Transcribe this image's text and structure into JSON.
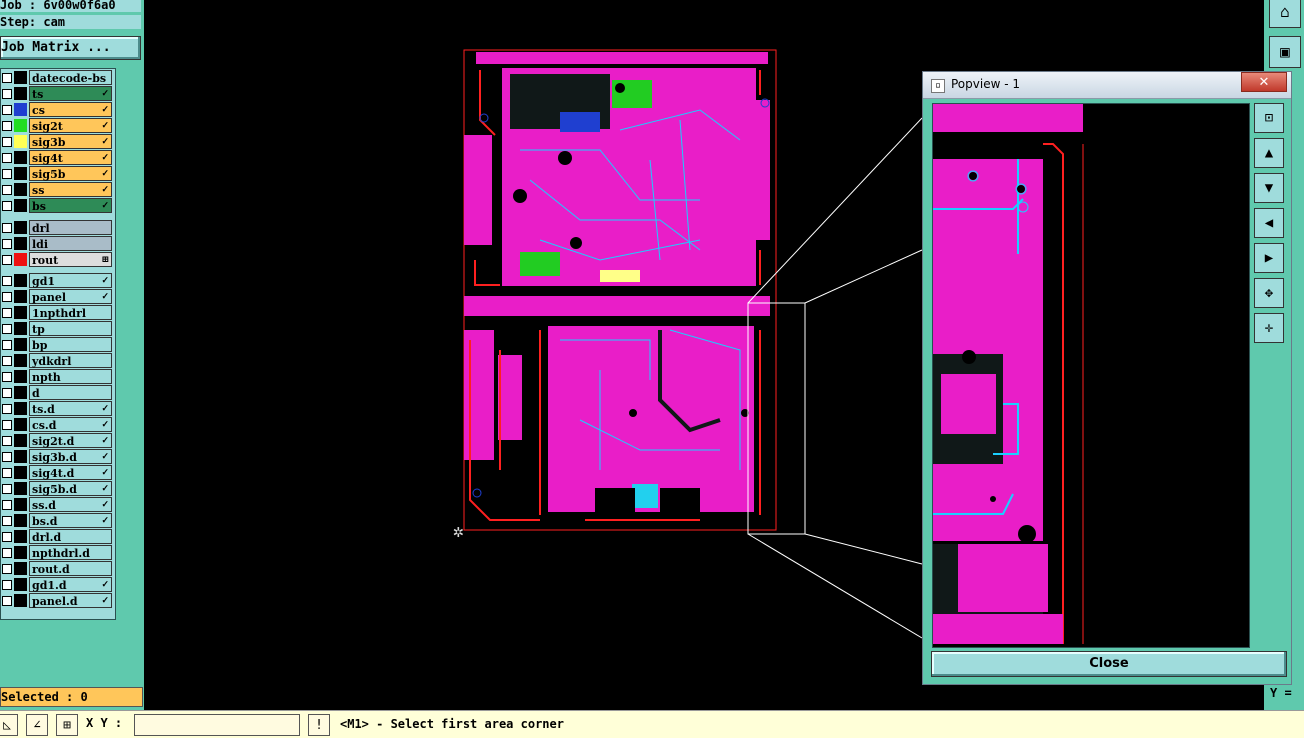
{
  "header": {
    "job_label": "Job : 6v00w0f6a0",
    "step_label": "Step: cam",
    "job_matrix_button": "Job Matrix ..."
  },
  "layers": [
    {
      "name": "datecode-bs",
      "color": "#9fdcdc",
      "swatch": "#000000",
      "tick": ""
    },
    {
      "name": "ts",
      "color": "#2e8b57",
      "swatch": "#000000",
      "tick": "✓"
    },
    {
      "name": "cs",
      "color": "#ffc65a",
      "swatch": "#1f3fd0",
      "tick": "✓"
    },
    {
      "name": "sig2t",
      "color": "#ffc65a",
      "swatch": "#22dd22",
      "tick": "✓"
    },
    {
      "name": "sig3b",
      "color": "#ffc65a",
      "swatch": "#ffff55",
      "tick": "✓"
    },
    {
      "name": "sig4t",
      "color": "#ffc65a",
      "swatch": "#000000",
      "tick": "✓"
    },
    {
      "name": "sig5b",
      "color": "#ffc65a",
      "swatch": "#000000",
      "tick": "✓"
    },
    {
      "name": "ss",
      "color": "#ffc65a",
      "swatch": "#000000",
      "tick": "✓"
    },
    {
      "name": "bs",
      "color": "#2e8b57",
      "swatch": "#000000",
      "tick": "✓"
    },
    {
      "name": "drl",
      "color": "#a9bcc8",
      "swatch": "#000000",
      "tick": ""
    },
    {
      "name": "ldi",
      "color": "#a9bcc8",
      "swatch": "#000000",
      "tick": ""
    },
    {
      "name": "rout",
      "color": "#dddddd",
      "swatch": "#ee1111",
      "tick": "⊞"
    },
    {
      "name": "gd1",
      "color": "#9fdcdc",
      "swatch": "#000000",
      "tick": "✓"
    },
    {
      "name": "panel",
      "color": "#9fdcdc",
      "swatch": "#000000",
      "tick": "✓"
    },
    {
      "name": "1npthdrl",
      "color": "#9fdcdc",
      "swatch": "#000000",
      "tick": ""
    },
    {
      "name": "tp",
      "color": "#9fdcdc",
      "swatch": "#000000",
      "tick": ""
    },
    {
      "name": "bp",
      "color": "#9fdcdc",
      "swatch": "#000000",
      "tick": ""
    },
    {
      "name": "ydkdrl",
      "color": "#9fdcdc",
      "swatch": "#000000",
      "tick": ""
    },
    {
      "name": "npth",
      "color": "#9fdcdc",
      "swatch": "#000000",
      "tick": ""
    },
    {
      "name": "d",
      "color": "#9fdcdc",
      "swatch": "#000000",
      "tick": ""
    },
    {
      "name": "ts.d",
      "color": "#9fdcdc",
      "swatch": "#000000",
      "tick": "✓"
    },
    {
      "name": "cs.d",
      "color": "#9fdcdc",
      "swatch": "#000000",
      "tick": "✓"
    },
    {
      "name": "sig2t.d",
      "color": "#9fdcdc",
      "swatch": "#000000",
      "tick": "✓"
    },
    {
      "name": "sig3b.d",
      "color": "#9fdcdc",
      "swatch": "#000000",
      "tick": "✓"
    },
    {
      "name": "sig4t.d",
      "color": "#9fdcdc",
      "swatch": "#000000",
      "tick": "✓"
    },
    {
      "name": "sig5b.d",
      "color": "#9fdcdc",
      "swatch": "#000000",
      "tick": "✓"
    },
    {
      "name": "ss.d",
      "color": "#9fdcdc",
      "swatch": "#000000",
      "tick": "✓"
    },
    {
      "name": "bs.d",
      "color": "#9fdcdc",
      "swatch": "#000000",
      "tick": "✓"
    },
    {
      "name": "drl.d",
      "color": "#9fdcdc",
      "swatch": "#000000",
      "tick": ""
    },
    {
      "name": "npthdrl.d",
      "color": "#9fdcdc",
      "swatch": "#000000",
      "tick": ""
    },
    {
      "name": "rout.d",
      "color": "#9fdcdc",
      "swatch": "#000000",
      "tick": ""
    },
    {
      "name": "gd1.d",
      "color": "#9fdcdc",
      "swatch": "#000000",
      "tick": "✓"
    },
    {
      "name": "panel.d",
      "color": "#9fdcdc",
      "swatch": "#000000",
      "tick": "✓"
    }
  ],
  "selected_label": "Selected : 0",
  "bottom": {
    "xy_label": "X Y :",
    "xy_value": "",
    "status": "<M1> - Select first area corner"
  },
  "right_panel": {
    "y_label": "Y ="
  },
  "popup": {
    "title": "Popview - 1",
    "close_x": "✕",
    "close_button": "Close"
  },
  "colors": {
    "teal": "#5fc9ad",
    "magenta": "#e91ec8",
    "rout_red": "#ff2020"
  }
}
